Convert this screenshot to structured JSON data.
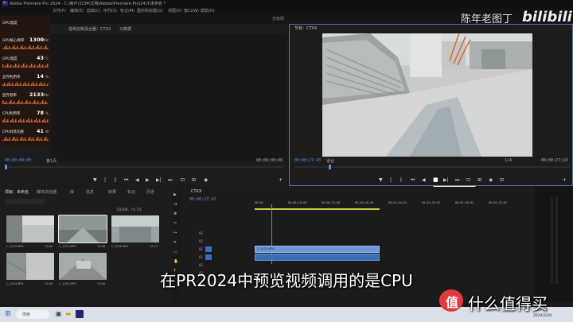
{
  "window": {
    "title": "Adobe Premiere Pro 2024 - C:\\用户\\3234\\文档\\Adobe\\Premiere Pro\\24.0\\未命名 *",
    "menu": [
      "文件(F)",
      "编辑(E)",
      "剪辑(C)",
      "序列(S)",
      "标记(M)",
      "图形和标题(G)",
      "视图(V)",
      "窗口(W)",
      "帮助(H)"
    ],
    "workspace": "无标题"
  },
  "hw_monitor": {
    "rows": [
      {
        "label": "GPU温度",
        "value": "",
        "unit": ""
      },
      {
        "label": "GPU核心频率",
        "value": "1300",
        "unit": "MHz"
      },
      {
        "label": "GPU温度",
        "value": "43",
        "unit": "°C"
      },
      {
        "label": "显存利用率",
        "value": "14",
        "unit": "%"
      },
      {
        "label": "显存频率",
        "value": "2133",
        "unit": "MHz"
      },
      {
        "label": "CPU利用率",
        "value": "78",
        "unit": "%"
      },
      {
        "label": "CPU封装功耗",
        "value": "41",
        "unit": "W"
      }
    ],
    "bar_color": "#c8623a"
  },
  "source_monitor": {
    "tabs": [
      "效果控件",
      "音频剪辑混合器：CTXX",
      "元数据"
    ],
    "timecode_left": "00;00;00;00",
    "page": "第1页",
    "timecode_right": "00;00;00;00"
  },
  "program_monitor": {
    "title": "节目：CTXX",
    "timecode_left": "00;00;27;43",
    "fit": "适合",
    "ratio": "1/4",
    "timecode_right": "00;00;27;18",
    "tooltip": "播放 - 停止切换 (空格键)"
  },
  "project_panel": {
    "tabs": [
      "项目：未命名",
      "媒体浏览器",
      "库",
      "信息",
      "效果",
      "标记",
      "历史"
    ],
    "search_placeholder": "",
    "item_count": "1项选择，共11项",
    "thumbs": [
      {
        "label": "C_1025.MP4",
        "dur": "13;06"
      },
      {
        "label": "C_1051.MP4",
        "dur": "13;06"
      },
      {
        "label": "C_1026.MP4",
        "dur": "15;17"
      },
      {
        "label": "C_1024.MP4",
        "dur": "13;06"
      },
      {
        "label": "C_1031.MP4",
        "dur": "13;06"
      }
    ]
  },
  "timeline": {
    "tab": "CTXX",
    "timecode": "00;00;27;43",
    "rulers": [
      "00;00",
      "00;00;16;00",
      "00;00;32;00",
      "00;00;48;00",
      "00;01;04;02",
      "00;01;20;02",
      "00;01;36;02",
      "00;01;52;02"
    ],
    "tracks": [
      "V3",
      "V2",
      "V1",
      "A1",
      "A2",
      "A3"
    ],
    "clip_label": "C_1025.MP4"
  },
  "subtitle": "在PR2024中预览视频调用的是CPU",
  "watermark_top": "陈年老图丁",
  "watermark_bili": "bilibili",
  "watermark_bottom": "什么值得买",
  "taskbar": {
    "search": "搜索",
    "time": "20:36",
    "date": "2024/2/29"
  }
}
